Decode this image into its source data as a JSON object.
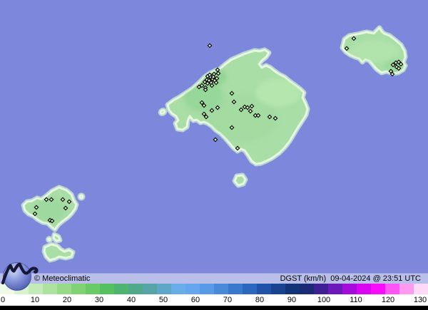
{
  "footer": {
    "credit": "© Meteoclimatic",
    "variable": "DGST (km/h)",
    "timestamp": "09-04-2024 @ 23:51 UTC",
    "right_text": "DGST (km/h)  09-04-2024 @ 23:51 UTC"
  },
  "scale": {
    "units": "km/h",
    "min": 0,
    "max": 130,
    "ticks": [
      "0",
      "10",
      "20",
      "30",
      "40",
      "50",
      "60",
      "70",
      "80",
      "90",
      "100",
      "110",
      "120",
      "130"
    ],
    "tick_start_x": 4,
    "tick_spacing_px": 45,
    "segment_colors": [
      "#eef9ea",
      "#d9f2d0",
      "#c3ebb7",
      "#ace39e",
      "#96db88",
      "#80d375",
      "#6aca66",
      "#55c060",
      "#4fb372",
      "#51a98c",
      "#55a4a6",
      "#5da7c8",
      "#68ace8",
      "#66a6ef",
      "#579ae6",
      "#478ada",
      "#3879ce",
      "#2b66bf",
      "#2053a8",
      "#174390",
      "#113377",
      "#1b2a74",
      "#3e2094",
      "#6c18ba",
      "#a30cda",
      "#d904f2",
      "#fb0bfc",
      "#ff55f6",
      "#ff9af0",
      "#ffd9f8"
    ]
  },
  "map": {
    "sea_color": "#7d88dc",
    "island_fill": "#a9dea6",
    "coast_glow": "#e7f7e0",
    "coast_halo": "#c2e2d2",
    "marker_fill": "#d4eec8",
    "marker_stroke": "#000000",
    "stations": [
      [
        294,
        64
      ],
      [
        305,
        98
      ],
      [
        300,
        104
      ],
      [
        306,
        103
      ],
      [
        291,
        107
      ],
      [
        295,
        108
      ],
      [
        298,
        111
      ],
      [
        290,
        112
      ],
      [
        293,
        113
      ],
      [
        287,
        115
      ],
      [
        291,
        117
      ],
      [
        296,
        116
      ],
      [
        301,
        113
      ],
      [
        304,
        110
      ],
      [
        294,
        105
      ],
      [
        299,
        108
      ],
      [
        303,
        116
      ],
      [
        297,
        120
      ],
      [
        283,
        120
      ],
      [
        279,
        122
      ],
      [
        288,
        123
      ],
      [
        288,
        126
      ],
      [
        325,
        131
      ],
      [
        328,
        143
      ],
      [
        283,
        144
      ],
      [
        286,
        148
      ],
      [
        297,
        155
      ],
      [
        305,
        151
      ],
      [
        338,
        154
      ],
      [
        343,
        150
      ],
      [
        347,
        151
      ],
      [
        353,
        149
      ],
      [
        351,
        156
      ],
      [
        358,
        162
      ],
      [
        362,
        162
      ],
      [
        378,
        164
      ],
      [
        386,
        166
      ],
      [
        286,
        160
      ],
      [
        289,
        164
      ],
      [
        325,
        179
      ],
      [
        302,
        196
      ],
      [
        333,
        208
      ],
      [
        496,
        54
      ],
      [
        486,
        68
      ],
      [
        551,
        91
      ],
      [
        555,
        88
      ],
      [
        559,
        87
      ],
      [
        562,
        90
      ],
      [
        556,
        94
      ],
      [
        559,
        96
      ],
      [
        548,
        100
      ],
      [
        550,
        104
      ],
      [
        65,
        280
      ],
      [
        72,
        280
      ],
      [
        88,
        280
      ],
      [
        97,
        283
      ],
      [
        51,
        291
      ],
      [
        92,
        292
      ],
      [
        49,
        300
      ],
      [
        70,
        309
      ],
      [
        73,
        310
      ]
    ]
  }
}
